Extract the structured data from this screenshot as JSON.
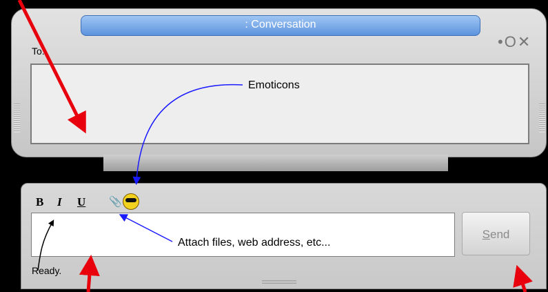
{
  "window": {
    "title": ": Conversation",
    "controls": "•O✕"
  },
  "history": {
    "to_label": "To:"
  },
  "compose": {
    "bold": "B",
    "italic": "I",
    "underline": "U",
    "attach_icon": "paperclip-icon",
    "emoticon_icon": "sunglasses-smiley-icon",
    "send_label": "Send",
    "send_accesskey": "S"
  },
  "status": {
    "text": "Ready."
  },
  "annotations": {
    "emoticons": "Emoticons",
    "attach": "Attach files, web address, etc..."
  },
  "colors": {
    "title_bar": "#5d93de",
    "arrow_red": "#e8000d",
    "arrow_blue": "#1a1aff",
    "smiley": "#f3d11f"
  }
}
